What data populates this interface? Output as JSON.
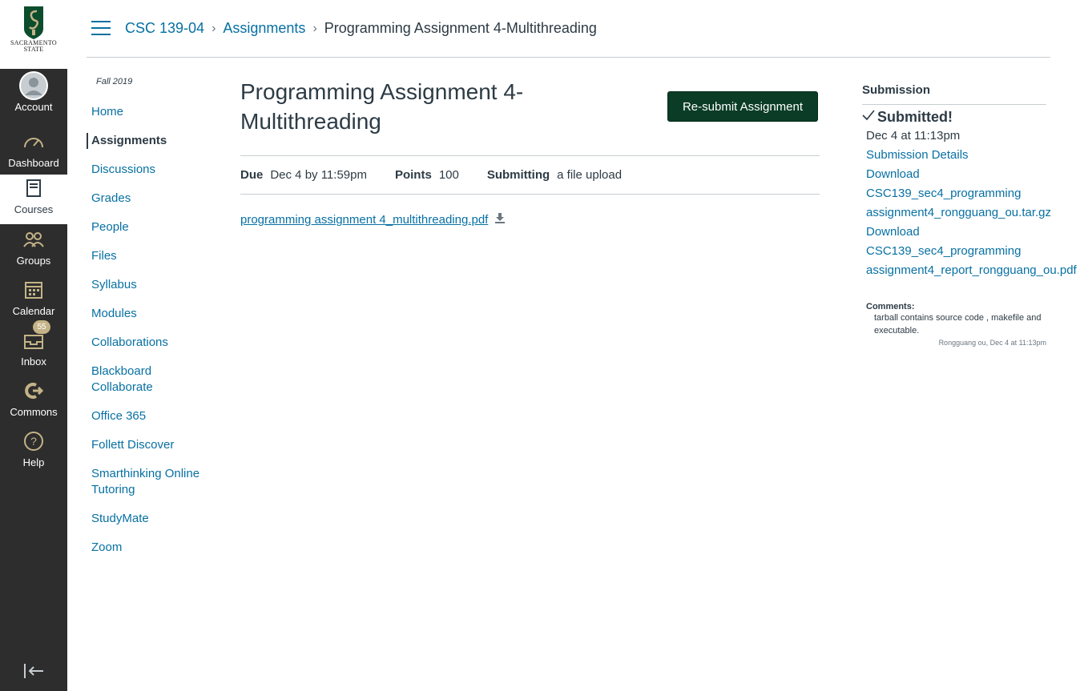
{
  "global_nav": {
    "logo_line1": "SACRAMENTO",
    "logo_line2": "STATE",
    "items": [
      {
        "label": "Account",
        "icon": "avatar-icon"
      },
      {
        "label": "Dashboard",
        "icon": "dashboard-icon"
      },
      {
        "label": "Courses",
        "icon": "courses-icon"
      },
      {
        "label": "Groups",
        "icon": "groups-icon"
      },
      {
        "label": "Calendar",
        "icon": "calendar-icon"
      },
      {
        "label": "Inbox",
        "icon": "inbox-icon",
        "badge": "55"
      },
      {
        "label": "Commons",
        "icon": "commons-icon"
      },
      {
        "label": "Help",
        "icon": "help-icon"
      }
    ]
  },
  "breadcrumb": {
    "course": "CSC 139-04",
    "section": "Assignments",
    "current": "Programming Assignment 4-Multithreading"
  },
  "course_nav": {
    "term": "Fall 2019",
    "items": [
      "Home",
      "Assignments",
      "Discussions",
      "Grades",
      "People",
      "Files",
      "Syllabus",
      "Modules",
      "Collaborations",
      "Blackboard Collaborate",
      "Office 365",
      "Follett Discover",
      "Smarthinking Online Tutoring",
      "StudyMate",
      "Zoom"
    ],
    "active": "Assignments"
  },
  "assignment": {
    "title": "Programming Assignment 4-Multithreading",
    "resubmit_label": "Re-submit Assignment",
    "due_label": "Due",
    "due_value": "Dec 4 by 11:59pm",
    "points_label": "Points",
    "points_value": "100",
    "submitting_label": "Submitting",
    "submitting_value": "a file upload",
    "file_name": "programming assignment 4_multithreading.pdf"
  },
  "submission": {
    "title": "Submission",
    "status": "Submitted!",
    "date": "Dec 4 at 11:13pm",
    "details_link": "Submission Details",
    "download_label": "Download",
    "file1_line1": "CSC139_sec4_programming",
    "file1_line2": "assignment4_rongguang_ou.tar.gz",
    "file2_line1": "CSC139_sec4_programming",
    "file2_line2": "assignment4_report_rongguang_ou.pdf",
    "comments_label": "Comments:",
    "comment_text": "tarball contains source code , makefile and executable.",
    "comment_meta": "Rongguang ou, Dec 4 at 11:13pm"
  },
  "colors": {
    "global_nav_bg": "#2d2d2d",
    "link": "#0770a3",
    "button_bg": "#0b3d26",
    "badge": "#c4b387",
    "text": "#2d3b45"
  }
}
